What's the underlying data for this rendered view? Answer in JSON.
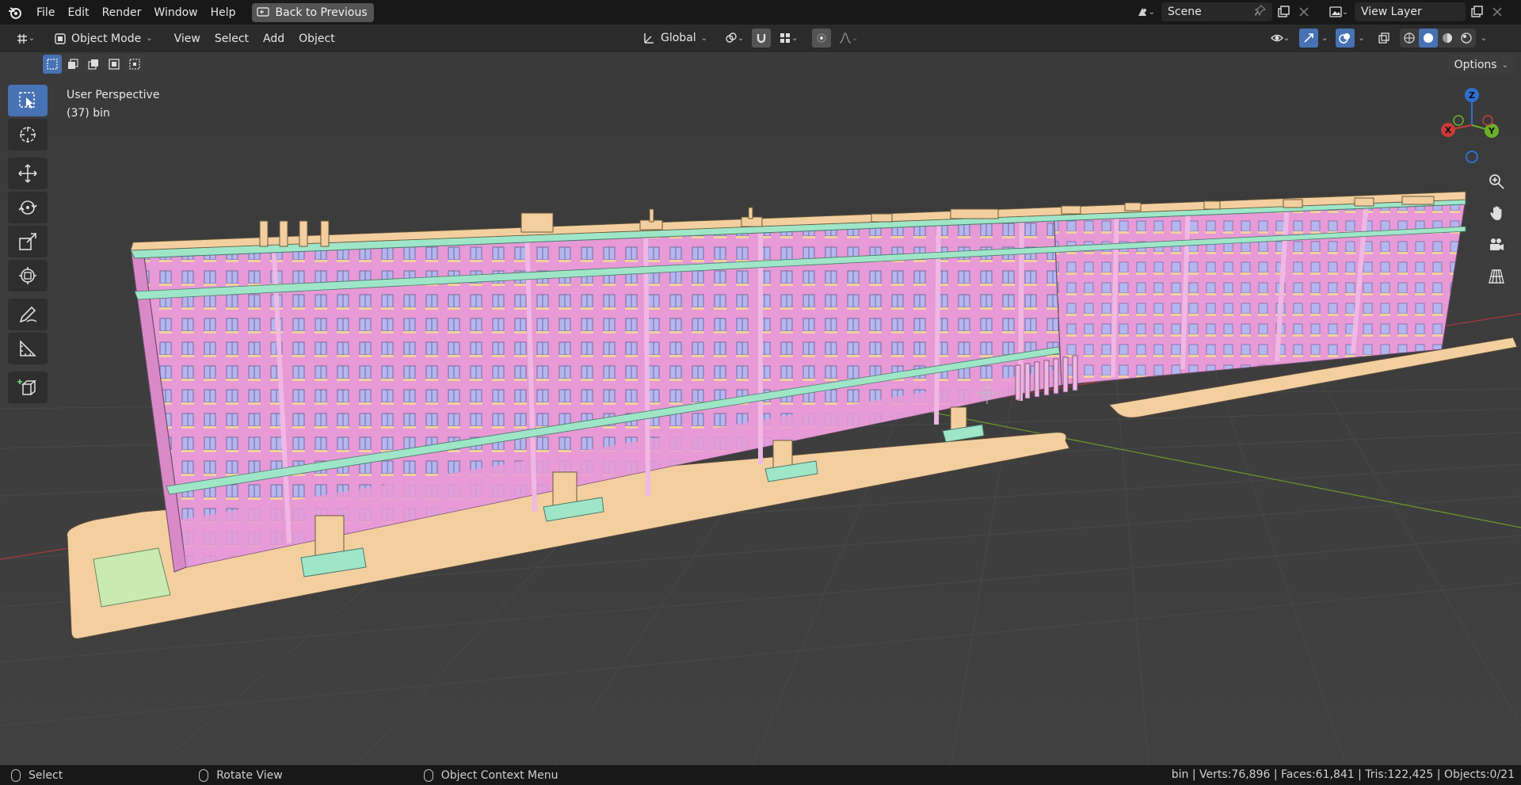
{
  "topbar": {
    "menus": [
      "File",
      "Edit",
      "Render",
      "Window",
      "Help"
    ],
    "back_label": "Back to Previous",
    "scene_name": "Scene",
    "view_layer": "View Layer"
  },
  "header": {
    "mode": "Object Mode",
    "menus": [
      "View",
      "Select",
      "Add",
      "Object"
    ],
    "transform_orientation": "Global",
    "options_label": "Options"
  },
  "viewport": {
    "perspective_label": "User Perspective",
    "object_label": "(37) bin",
    "axes": {
      "x": "X",
      "y": "Y",
      "z": "Z"
    },
    "colors": {
      "background": "#3d3d3d",
      "grid": "#464646",
      "wall": "#e79ad6",
      "base": "#f3cfa0",
      "trim": "#9fe6c8",
      "window": "#b4b6f0",
      "x_axis": "#a83a3a",
      "y_axis": "#6b9a2a"
    }
  },
  "toolbar": {
    "tools": [
      "select-box",
      "cursor",
      "move",
      "rotate",
      "scale",
      "transform",
      "annotate",
      "measure",
      "add-cube"
    ]
  },
  "statusbar": {
    "left_label": "Select",
    "middle_label": "Rotate View",
    "right_label": "Object Context Menu",
    "stats": "bin | Verts:76,896 | Faces:61,841 | Tris:122,425 | Objects:0/21"
  }
}
